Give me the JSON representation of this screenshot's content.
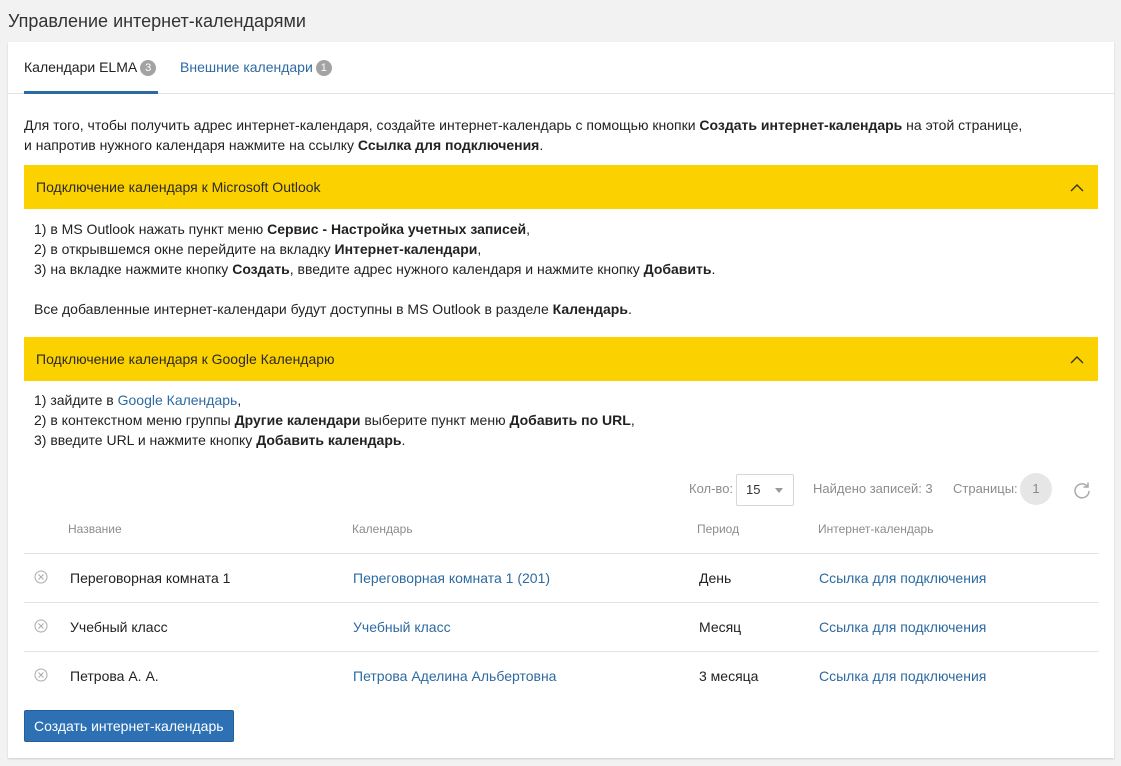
{
  "page": {
    "title": "Управление интернет-календарями"
  },
  "tabs": [
    {
      "label": "Календари ELMA",
      "count": "3"
    },
    {
      "label": "Внешние календари",
      "count": "1"
    }
  ],
  "intro": {
    "t1": "Для того, чтобы получить адрес интернет-календаря, создайте интернет-календарь с помощью кнопки ",
    "b1": "Создать интернет-календарь",
    "t2": " на этой странице,",
    "t3": "и напротив нужного календаря нажмите на ссылку ",
    "b2": "Ссылка для подключения",
    "t4": "."
  },
  "outlook": {
    "header": "Подключение календаря к Microsoft Outlook",
    "l1a": "1) в MS Outlook нажать пункт меню ",
    "l1b": "Сервис - Настройка учетных записей",
    "l1c": ",",
    "l2a": "2) в открывшемся окне перейдите на вкладку ",
    "l2b": "Интернет-календари",
    "l2c": ",",
    "l3a": "3) на вкладке нажмите кнопку ",
    "l3b": "Создать",
    "l3c": ", введите адрес нужного календаря и нажмите кнопку ",
    "l3d": "Добавить",
    "l3e": ".",
    "n1": "Все добавленные интернет-календари будут доступны в MS Outlook в разделе ",
    "n2": "Календарь",
    "n3": "."
  },
  "google": {
    "header": "Подключение календаря к Google Календарю",
    "l1a": "1) зайдите в ",
    "l1link": "Google Календарь",
    "l1c": ",",
    "l2a": "2) в контекстном меню группы ",
    "l2b": "Другие календари",
    "l2c": " выберите пункт меню ",
    "l2d": "Добавить по URL",
    "l2e": ",",
    "l3a": "3) введите URL и нажмите кнопку ",
    "l3b": "Добавить календарь",
    "l3c": "."
  },
  "pager": {
    "qty_label": "Кол-во:",
    "qty_value": "15",
    "found": "Найдено записей: 3",
    "pages_label": "Страницы:",
    "page": "1"
  },
  "table": {
    "headers": [
      "Название",
      "Календарь",
      "Период",
      "Интернет-календарь"
    ],
    "rows": [
      {
        "name": "Переговорная комната 1",
        "calendar": "Переговорная комната 1 (201)",
        "period": "День",
        "link": "Ссылка для подключения"
      },
      {
        "name": "Учебный класс",
        "calendar": "Учебный класс",
        "period": "Месяц",
        "link": "Ссылка для подключения"
      },
      {
        "name": "Петрова А. А.",
        "calendar": "Петрова Аделина Альбертовна",
        "period": "3 месяца",
        "link": "Ссылка для подключения"
      }
    ]
  },
  "create_button": "Создать интернет-календарь",
  "colors": {
    "accent": "#2c6aa0",
    "header_bg": "#fcd100",
    "button": "#2d70b4"
  },
  "icons": {
    "collapse": "chevron-up-icon",
    "remove": "remove-circle-icon",
    "refresh": "refresh-icon"
  }
}
